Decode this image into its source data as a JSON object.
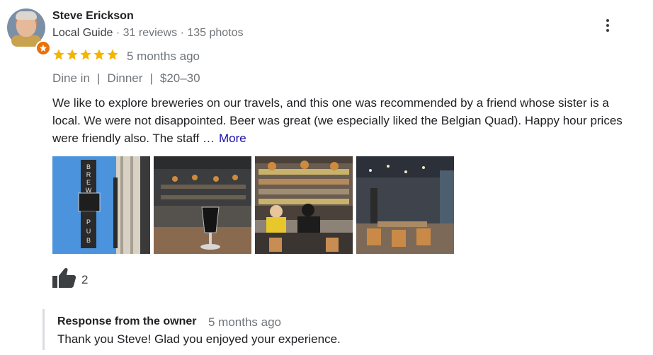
{
  "reviewer": {
    "name": "Steve Erickson",
    "guide_label": "Local Guide",
    "reviews": "31 reviews",
    "photos": "135 photos",
    "badge_icon": "local-guide-star-icon"
  },
  "rating": {
    "stars": 5,
    "max": 5,
    "time": "5 months ago",
    "star_color": "#f4b400"
  },
  "tags": [
    "Dine in",
    "Dinner",
    "$20–30"
  ],
  "review": {
    "text": "We like to explore breweries on our travels, and this one was recommended by a friend whose sister is a local. We were not disappointed. Beer was great (we especially liked the Belgian Quad). Happy hour prices were friendly also. The staff …",
    "more_label": "More"
  },
  "photos": [
    {
      "icon": "photo-brewpub-sign"
    },
    {
      "icon": "photo-beer-glass"
    },
    {
      "icon": "photo-bar-taps"
    },
    {
      "icon": "photo-dining-room"
    }
  ],
  "likes": {
    "count": "2",
    "icon": "thumbs-up-icon"
  },
  "owner_response": {
    "title": "Response from the owner",
    "time": "5 months ago",
    "text": "Thank you Steve! Glad you enjoyed your experience."
  },
  "colors": {
    "link": "#1a0dab",
    "badge": "#e8710a",
    "secondary_text": "#70757a"
  }
}
